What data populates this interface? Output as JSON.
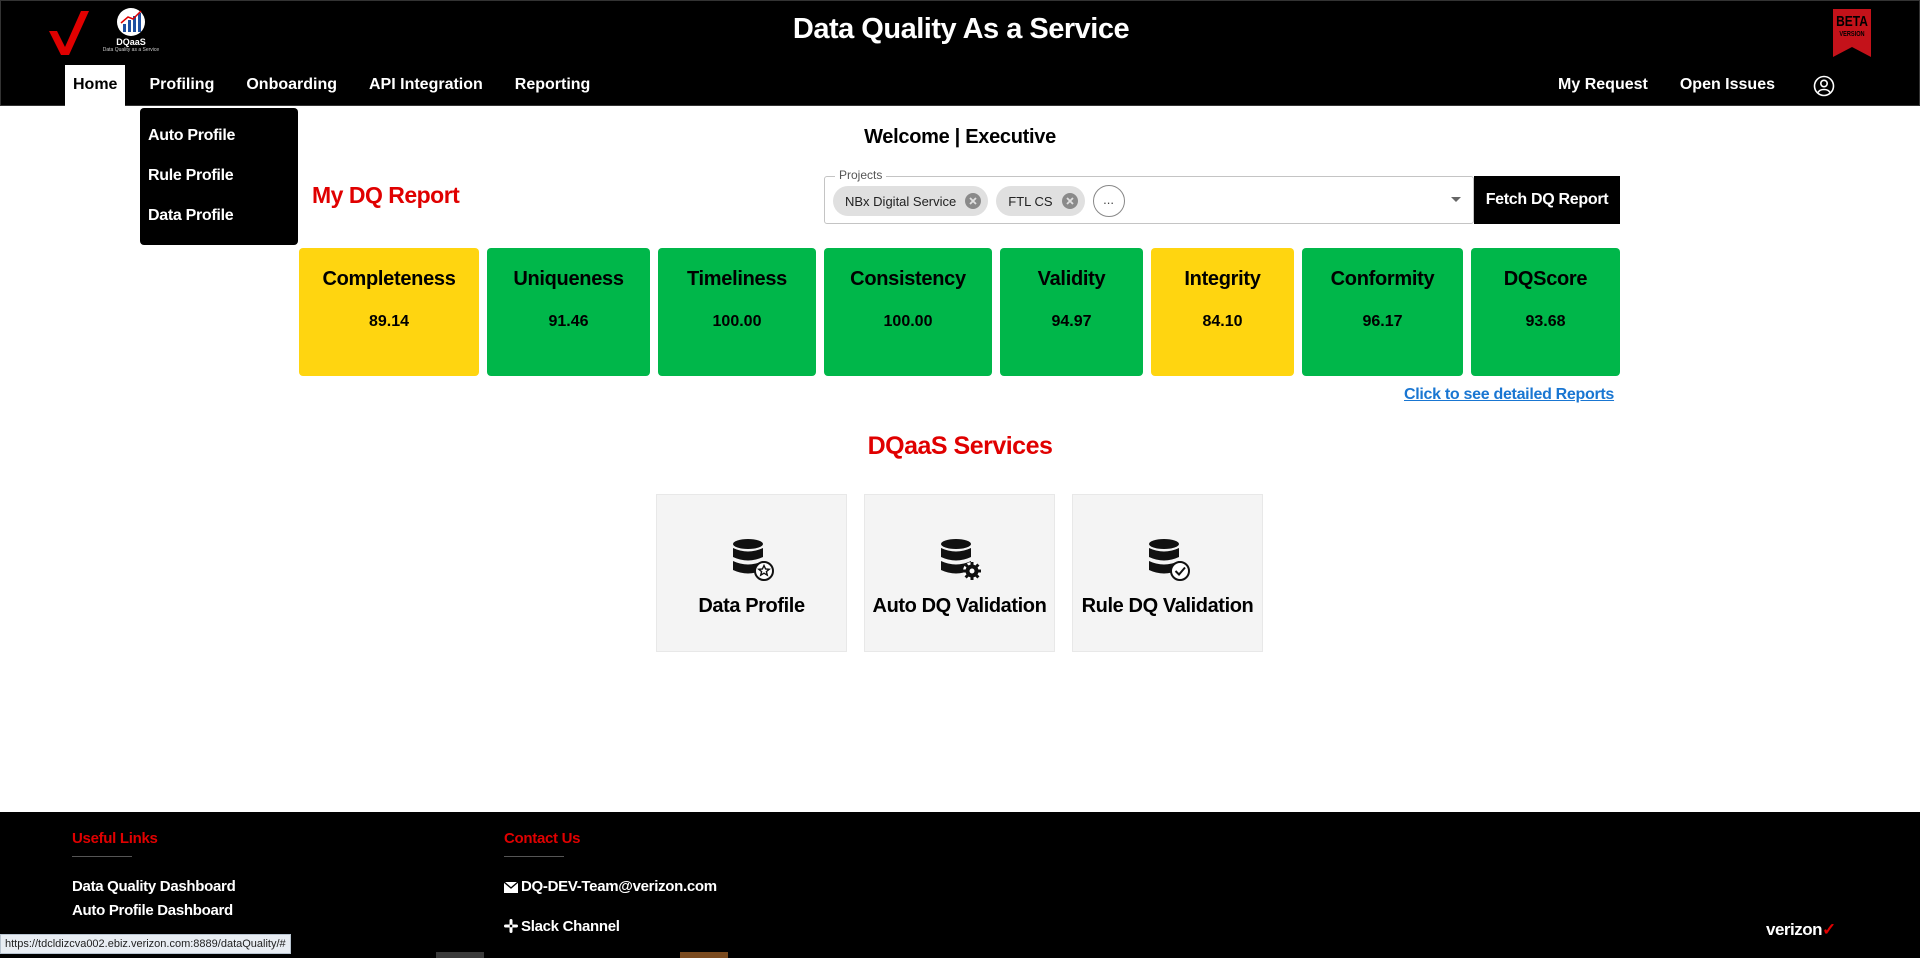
{
  "header": {
    "title": "Data Quality As a Service",
    "logo_text": "DQaaS",
    "logo_sub": "Data Quality as a Service",
    "beta_text": "BETA",
    "beta_sub": "VERSION"
  },
  "nav": {
    "items": [
      {
        "label": "Home",
        "active": true
      },
      {
        "label": "Profiling"
      },
      {
        "label": "Onboarding"
      },
      {
        "label": "API Integration"
      },
      {
        "label": "Reporting"
      }
    ],
    "right_items": [
      {
        "label": "My Request"
      },
      {
        "label": "Open Issues"
      }
    ]
  },
  "profiling_menu": {
    "items": [
      {
        "label": "Auto Profile"
      },
      {
        "label": "Rule Profile"
      },
      {
        "label": "Data Profile"
      }
    ]
  },
  "welcome": "Welcome | Executive",
  "report": {
    "title": "My DQ Report",
    "projects_label": "Projects",
    "selected_projects": [
      "NBx Digital Service",
      "FTL CS"
    ],
    "more_label": "...",
    "fetch_button": "Fetch DQ Report",
    "detail_link": "Click to see detailed Reports"
  },
  "metrics": [
    {
      "label": "Completeness",
      "value": "89.14",
      "status": "yellow"
    },
    {
      "label": "Uniqueness",
      "value": "91.46",
      "status": "green"
    },
    {
      "label": "Timeliness",
      "value": "100.00",
      "status": "green"
    },
    {
      "label": "Consistency",
      "value": "100.00",
      "status": "green"
    },
    {
      "label": "Validity",
      "value": "94.97",
      "status": "green"
    },
    {
      "label": "Integrity",
      "value": "84.10",
      "status": "yellow"
    },
    {
      "label": "Conformity",
      "value": "96.17",
      "status": "green"
    },
    {
      "label": "DQScore",
      "value": "93.68",
      "status": "green"
    }
  ],
  "services": {
    "title": "DQaaS Services",
    "cards": [
      {
        "label": "Data Profile",
        "icon": "database-star-icon"
      },
      {
        "label": "Auto DQ Validation",
        "icon": "database-gear-icon"
      },
      {
        "label": "Rule DQ Validation",
        "icon": "database-check-icon"
      }
    ]
  },
  "footer": {
    "useful_links_heading": "Useful Links",
    "useful_links": [
      "Data Quality Dashboard",
      "Auto Profile Dashboard"
    ],
    "contact_heading": "Contact Us",
    "contact_email": "DQ-DEV-Team@verizon.com",
    "slack_label": "Slack Channel",
    "brand": "verizon"
  },
  "status_url": "https://tdcldizcva002.ebiz.verizon.com:8889/dataQuality/#",
  "colors": {
    "accent_red": "#e00000",
    "metric_green": "#00b74a",
    "metric_yellow": "#ffd510",
    "link_blue": "#1976d2"
  }
}
